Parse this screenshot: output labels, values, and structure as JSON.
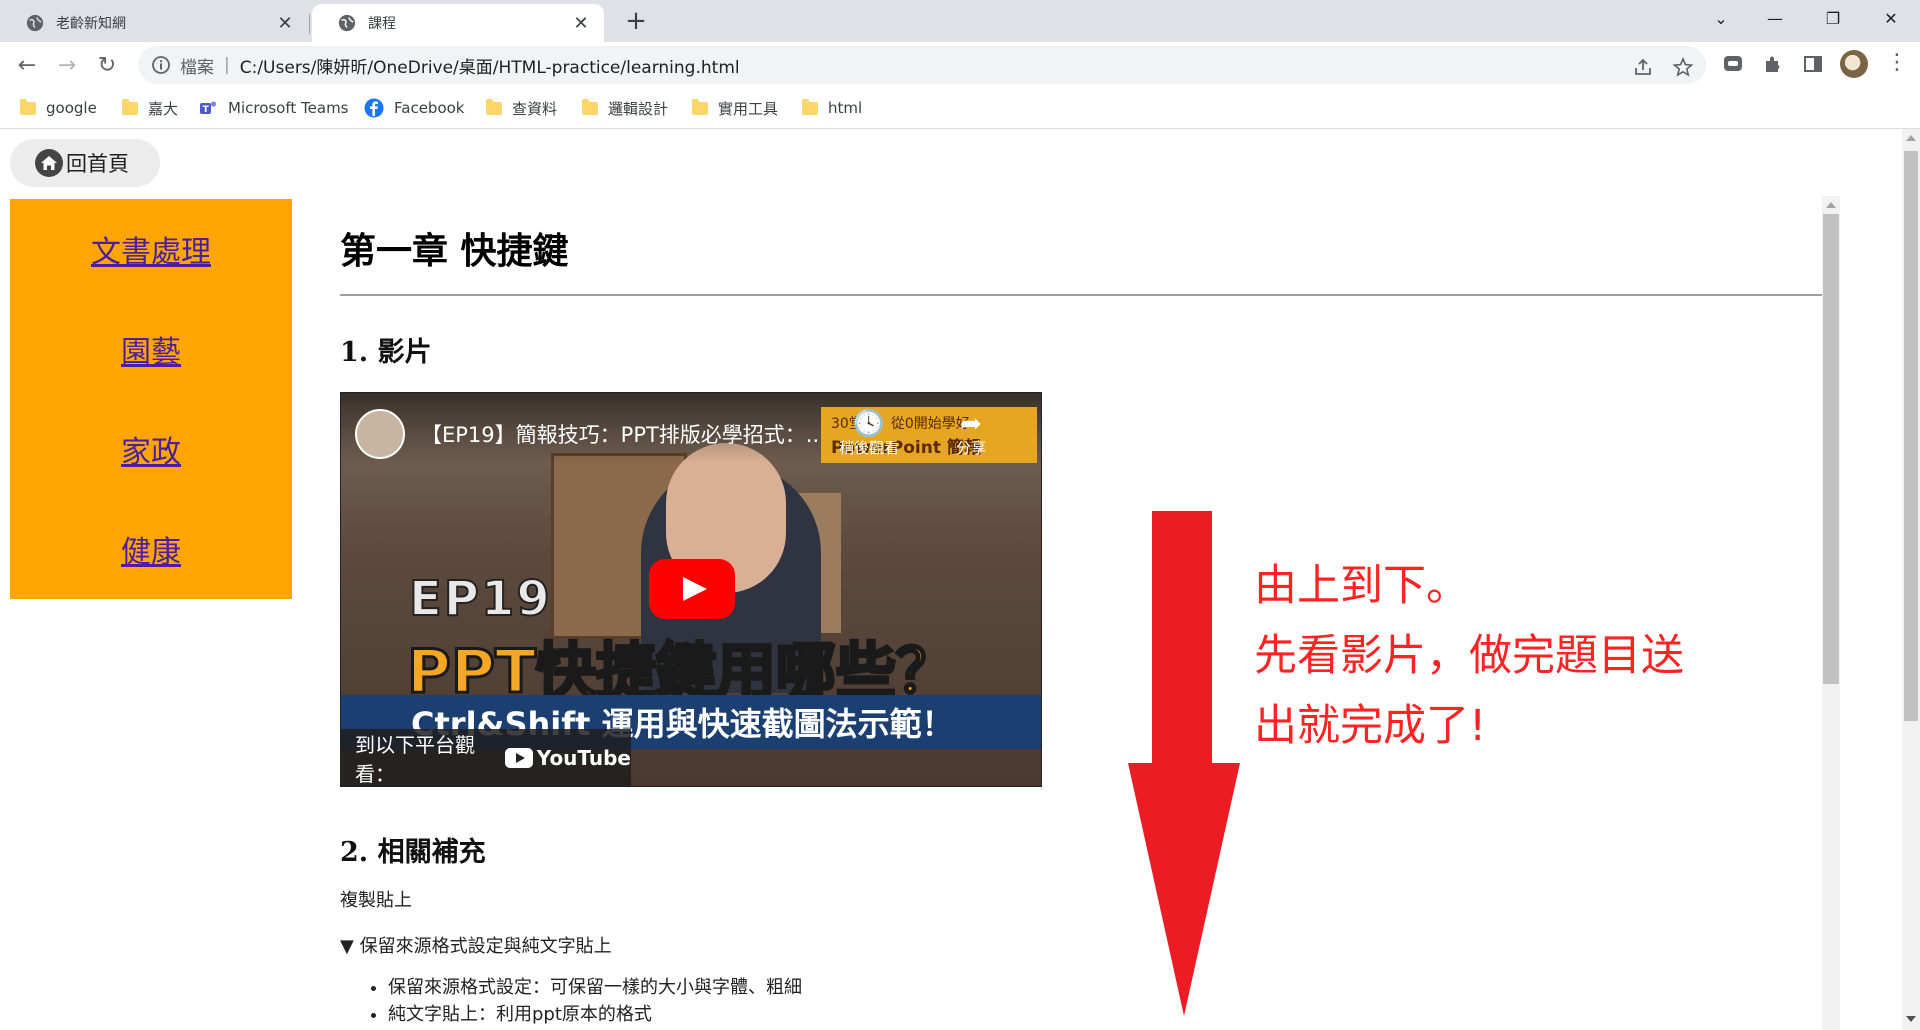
{
  "browser": {
    "tabs": [
      {
        "title": "老齡新知網"
      },
      {
        "title": "課程"
      }
    ],
    "address": {
      "scheme_label": "檔案",
      "url": "C:/Users/陳妍昕/OneDrive/桌面/HTML-practice/learning.html"
    },
    "bookmarks": [
      {
        "label": "google",
        "icon": "folder-icon"
      },
      {
        "label": "嘉大",
        "icon": "folder-icon"
      },
      {
        "label": "Microsoft Teams",
        "icon": "teams-icon"
      },
      {
        "label": "Facebook",
        "icon": "facebook-icon"
      },
      {
        "label": "查資料",
        "icon": "folder-icon"
      },
      {
        "label": "邏輯設計",
        "icon": "folder-icon"
      },
      {
        "label": "實用工具",
        "icon": "folder-icon"
      },
      {
        "label": "html",
        "icon": "folder-icon"
      }
    ]
  },
  "page": {
    "home_label": "回首頁",
    "sidebar": {
      "items": [
        {
          "label": "文書處理"
        },
        {
          "label": "園藝"
        },
        {
          "label": "家政"
        },
        {
          "label": "健康"
        }
      ],
      "background": "#ffa500",
      "link_color": "#4b1fa0"
    },
    "content": {
      "chapter_title": "第一章 快捷鍵",
      "section1": "1. 影片",
      "video": {
        "title": "【EP19】簡報技巧：PPT排版必學招式：...",
        "badge_top": "30堂課，從0開始學好",
        "badge_bottom": "PowerPoint 簡報",
        "watch_later": "稍後觀看",
        "share": "分享",
        "ep_text": "EP19",
        "headline": "PPT快捷鍵用哪些？",
        "subline": "Ctrl&Shift 運用與快速截圖法示範！",
        "watch_on": "到以下平台觀看：",
        "youtube": "YouTube"
      },
      "section2": "2. 相關補充",
      "copy_paste": "複製貼上",
      "details_summary": "▼ 保留來源格式設定與純文字貼上",
      "bullets": [
        "保留來源格式設定：可保留一樣的大小與字體、粗細",
        "純文字貼上：利用ppt原本的格式"
      ],
      "note_lines": [
        "由上到下。",
        "先看影片，做完題目送",
        "出就完成了!"
      ],
      "note_color": "#ff2323",
      "arrow_color": "#ed1c24"
    }
  }
}
